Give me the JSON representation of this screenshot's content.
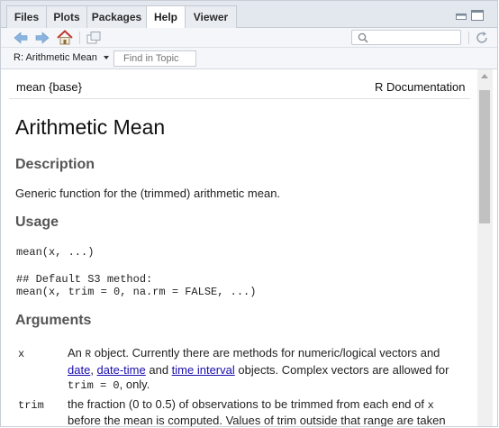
{
  "tabs": [
    {
      "label": "Files"
    },
    {
      "label": "Plots"
    },
    {
      "label": "Packages"
    },
    {
      "label": "Help"
    },
    {
      "label": "Viewer"
    }
  ],
  "active_tab": "Help",
  "helpbar": {
    "topic": "R: Arithmetic Mean",
    "find_placeholder": "Find in Topic"
  },
  "doc": {
    "header_left": "mean {base}",
    "header_right": "R Documentation",
    "title": "Arithmetic Mean",
    "sections": {
      "description": "Description",
      "usage": "Usage",
      "arguments": "Arguments"
    },
    "description_text": "Generic function for the (trimmed) arithmetic mean.",
    "usage_code_1": "mean(x, ...)",
    "usage_code_2": "## Default S3 method:",
    "usage_code_3": "mean(x, trim = 0, na.rm = FALSE, ...)",
    "args": [
      {
        "name": "x",
        "text_1": "An ",
        "code_1": "R",
        "text_2": " object. Currently there are methods for numeric/logical vectors and",
        "link_1": "date",
        "sep_1": ", ",
        "link_2": "date-time",
        "text_3": " and ",
        "link_3": "time interval",
        "text_4": " objects. Complex vectors are allowed for",
        "code_2": "trim = 0",
        "text_5": ", only."
      },
      {
        "name": "trim",
        "line_1_pre": "the fraction (0 to 0.5) of observations to be trimmed from each end of ",
        "line_1_code": "x",
        "line_2": "before the mean is computed. Values of trim outside that range are taken"
      }
    ]
  },
  "colors": {
    "tab_bar": "#e3e8ee",
    "active_tab": "#ffffff",
    "link": "#1a0dab",
    "section_heading": "#555555"
  }
}
